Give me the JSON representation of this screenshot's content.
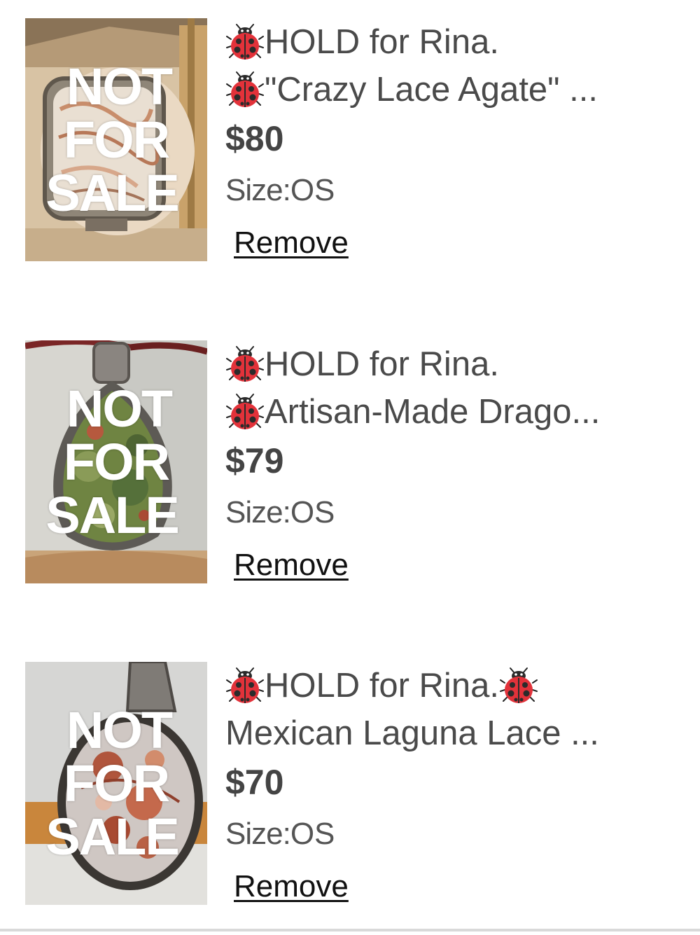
{
  "overlay_text": [
    "NOT",
    "FOR",
    "SALE"
  ],
  "icons": {
    "title_icon": "ladybug-icon"
  },
  "colors": {
    "title": "#4a4a4a",
    "price": "#444444",
    "size": "#555555",
    "remove": "#111111",
    "ladybug_red": "#e2323a"
  },
  "items": [
    {
      "title_line1": "HOLD for Rina.",
      "title_line2": "\"Crazy Lace Agate\" ...",
      "price": "$80",
      "size_label": "Size:",
      "size_value": "OS",
      "remove_label": "Remove",
      "image_desc": "crazy-lace-agate-ring"
    },
    {
      "title_line1": "HOLD for Rina.",
      "title_line2": "Artisan-Made Drago...",
      "price": "$79",
      "size_label": "Size:",
      "size_value": "OS",
      "remove_label": "Remove",
      "image_desc": "green-stone-teardrop-pendant"
    },
    {
      "title_line1": "HOLD for Rina.",
      "title_line2": "Mexican Laguna Lace ...",
      "price": "$70",
      "size_label": "Size:",
      "size_value": "OS",
      "remove_label": "Remove",
      "image_desc": "laguna-lace-agate-pendant"
    }
  ]
}
